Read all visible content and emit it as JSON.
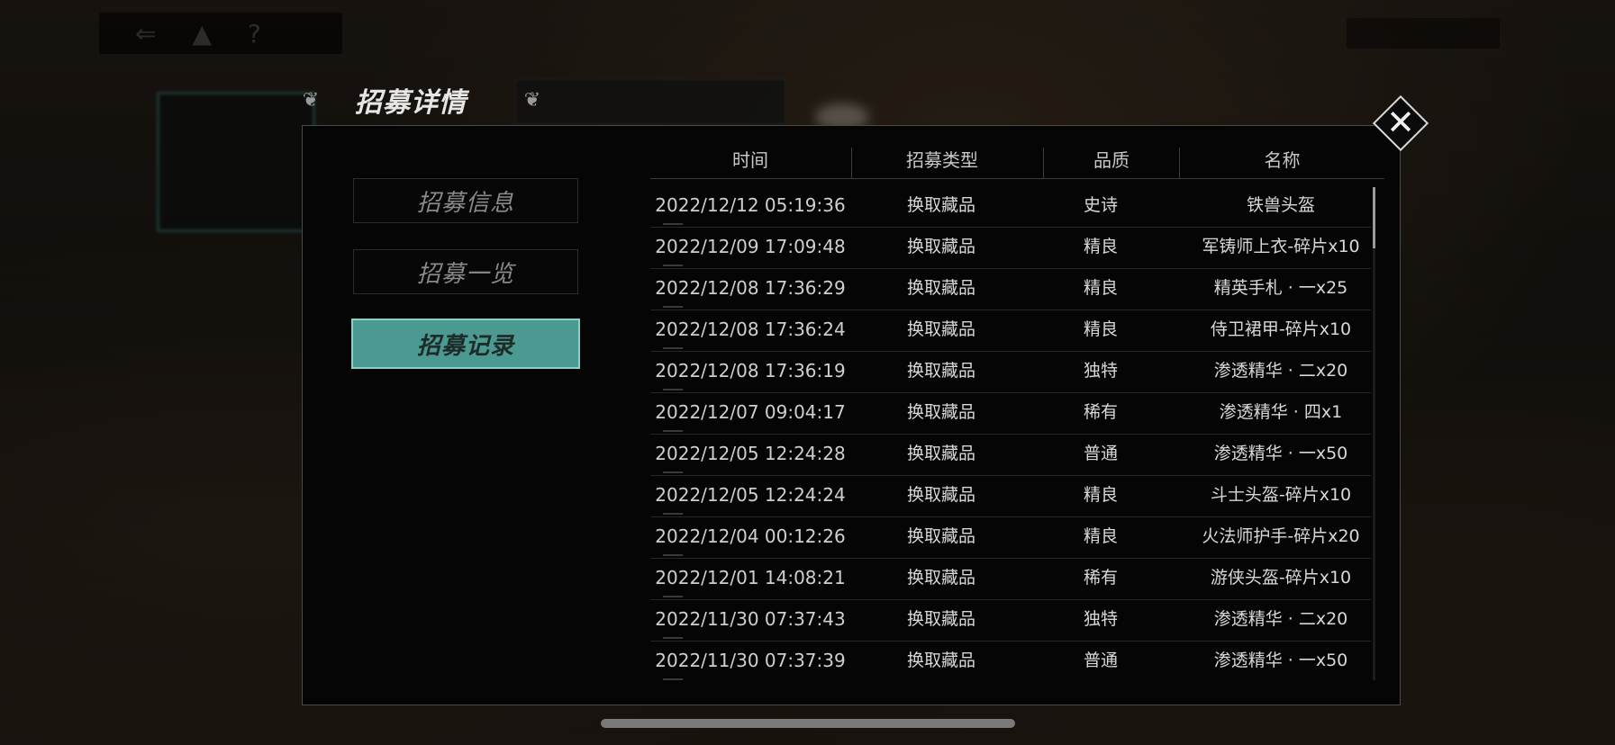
{
  "title": "招募详情",
  "close_icon": "close-icon",
  "menu": [
    {
      "label": "招募信息",
      "active": false
    },
    {
      "label": "招募一览",
      "active": false
    },
    {
      "label": "招募记录",
      "active": true
    }
  ],
  "table": {
    "headers": [
      "时间",
      "招募类型",
      "品质",
      "名称"
    ],
    "rows": [
      {
        "time": "2022/12/12 05:19:36",
        "type": "换取藏品",
        "quality": "史诗",
        "name": "铁兽头盔"
      },
      {
        "time": "2022/12/09 17:09:48",
        "type": "换取藏品",
        "quality": "精良",
        "name": "军铸师上衣-碎片x10"
      },
      {
        "time": "2022/12/08 17:36:29",
        "type": "换取藏品",
        "quality": "精良",
        "name": "精英手札 · 一x25"
      },
      {
        "time": "2022/12/08 17:36:24",
        "type": "换取藏品",
        "quality": "精良",
        "name": "侍卫裙甲-碎片x10"
      },
      {
        "time": "2022/12/08 17:36:19",
        "type": "换取藏品",
        "quality": "独特",
        "name": "渗透精华 · 二x20"
      },
      {
        "time": "2022/12/07 09:04:17",
        "type": "换取藏品",
        "quality": "稀有",
        "name": "渗透精华 · 四x1"
      },
      {
        "time": "2022/12/05 12:24:28",
        "type": "换取藏品",
        "quality": "普通",
        "name": "渗透精华 · 一x50"
      },
      {
        "time": "2022/12/05 12:24:24",
        "type": "换取藏品",
        "quality": "精良",
        "name": "斗士头盔-碎片x10"
      },
      {
        "time": "2022/12/04 00:12:26",
        "type": "换取藏品",
        "quality": "精良",
        "name": "火法师护手-碎片x20"
      },
      {
        "time": "2022/12/01 14:08:21",
        "type": "换取藏品",
        "quality": "稀有",
        "name": "游侠头盔-碎片x10"
      },
      {
        "time": "2022/11/30 07:37:43",
        "type": "换取藏品",
        "quality": "独特",
        "name": "渗透精华 · 二x20"
      },
      {
        "time": "2022/11/30 07:37:39",
        "type": "换取藏品",
        "quality": "普通",
        "name": "渗透精华 · 一x50"
      }
    ]
  },
  "scroll_position": 0
}
